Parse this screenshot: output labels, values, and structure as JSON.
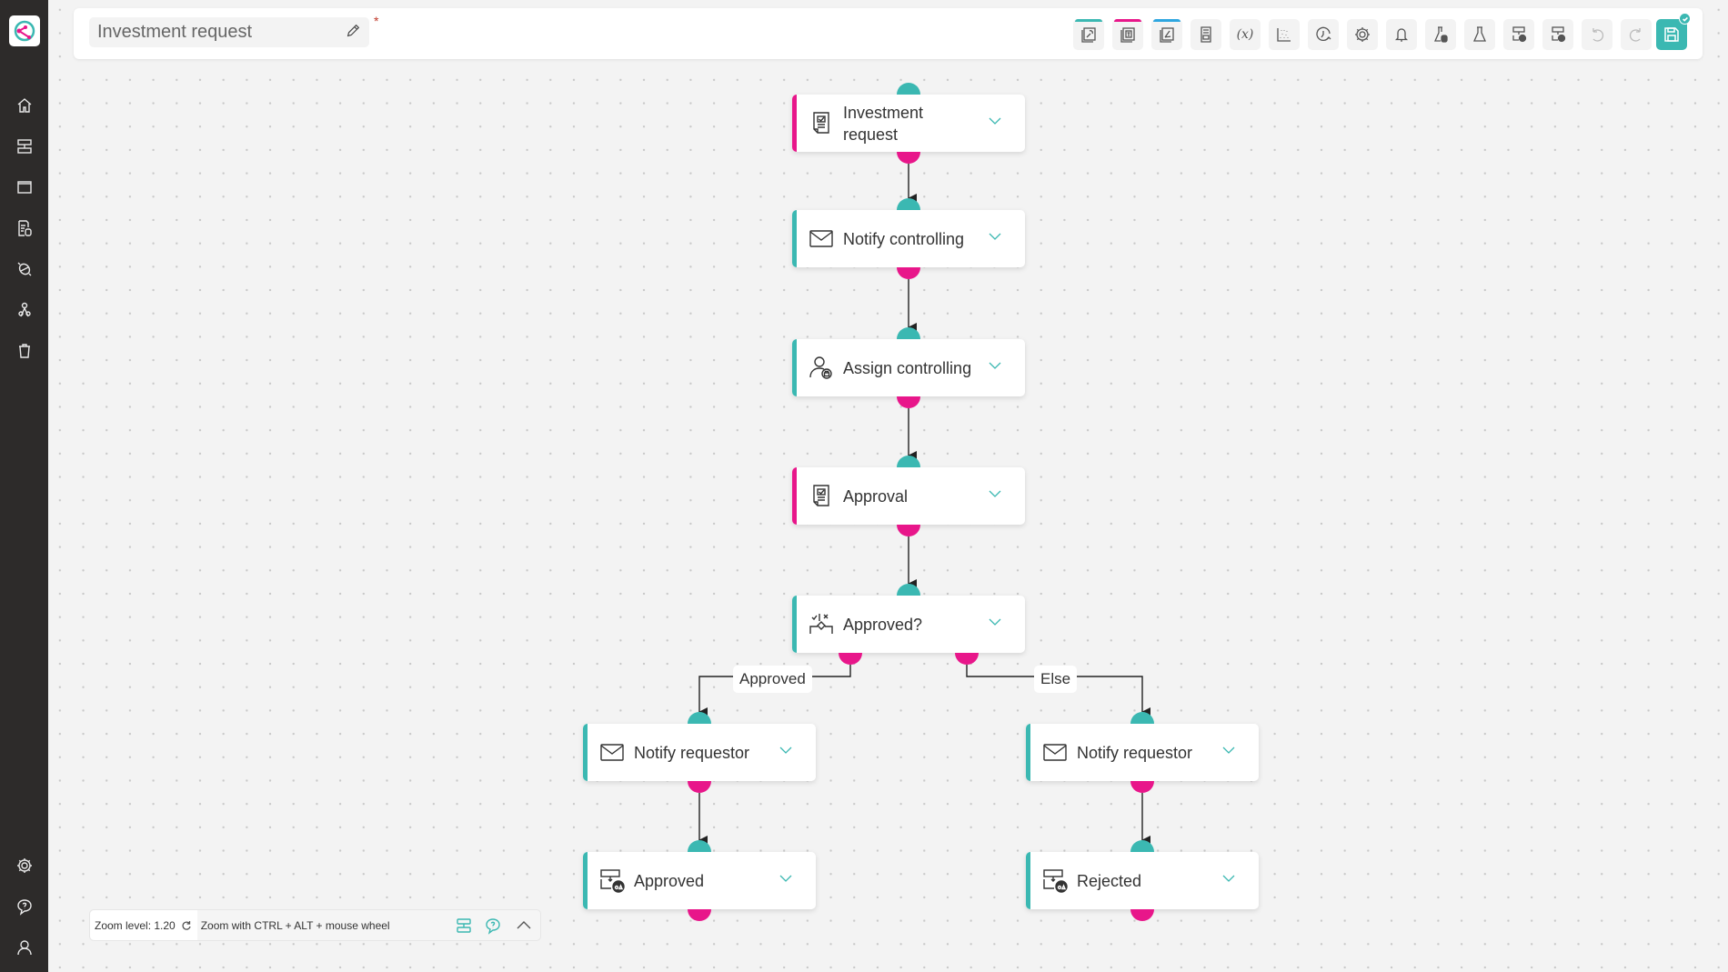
{
  "app": {
    "logo": "app-logo",
    "accent_color": "#3bb8b2",
    "secondary_color": "#e8168a",
    "sidebar_bg": "#2d2b2a"
  },
  "sidebar": {
    "top_items": [
      {
        "name": "home",
        "icon": "home-icon"
      },
      {
        "name": "processes",
        "icon": "process-icon"
      },
      {
        "name": "folders",
        "icon": "folder-icon"
      },
      {
        "name": "forms-db",
        "icon": "form-database-icon"
      },
      {
        "name": "integrations",
        "icon": "plug-icon"
      },
      {
        "name": "users",
        "icon": "users-icon"
      },
      {
        "name": "trash",
        "icon": "trash-icon"
      }
    ],
    "bottom_items": [
      {
        "name": "settings",
        "icon": "gear-icon"
      },
      {
        "name": "help",
        "icon": "help-bubble-icon"
      },
      {
        "name": "profile",
        "icon": "user-icon"
      }
    ]
  },
  "header": {
    "title": "Investment request",
    "unsaved_marker": "*",
    "toolbar": [
      {
        "name": "form-designer",
        "icon": "form-wrench-icon",
        "accent": "#3bb8b2"
      },
      {
        "name": "template-designer",
        "icon": "template-text-icon",
        "accent": "#e8168a"
      },
      {
        "name": "signature-designer",
        "icon": "signature-icon",
        "accent": "#2ea6e0"
      },
      {
        "name": "document",
        "icon": "document-icon"
      },
      {
        "name": "variables",
        "icon": "variables-icon",
        "text": "(x)"
      },
      {
        "name": "data-scatter",
        "icon": "data-dots-icon"
      },
      {
        "name": "schedule",
        "icon": "clock-refresh-icon"
      },
      {
        "name": "settings",
        "icon": "gear-icon"
      },
      {
        "name": "notifications",
        "icon": "bell-icon"
      },
      {
        "name": "test-data",
        "icon": "flask-database-icon"
      },
      {
        "name": "test",
        "icon": "flask-icon"
      },
      {
        "name": "run-report-1",
        "icon": "process-report-icon"
      },
      {
        "name": "run-report-2",
        "icon": "process-report-icon"
      },
      {
        "name": "undo",
        "icon": "undo-icon",
        "disabled": true
      },
      {
        "name": "redo",
        "icon": "redo-icon",
        "disabled": true
      }
    ],
    "save": {
      "icon": "save-icon",
      "status": "saved"
    }
  },
  "workflow": {
    "nodes": [
      {
        "id": "n1",
        "label": "Investment request",
        "type": "form",
        "bar": "#e8168a"
      },
      {
        "id": "n2",
        "label": "Notify controlling",
        "type": "email",
        "bar": "#3bb8b2"
      },
      {
        "id": "n3",
        "label": "Assign controlling",
        "type": "assign",
        "bar": "#3bb8b2"
      },
      {
        "id": "n4",
        "label": "Approval",
        "type": "form",
        "bar": "#e8168a"
      },
      {
        "id": "n5",
        "label": "Approved?",
        "type": "decision",
        "bar": "#3bb8b2"
      },
      {
        "id": "n6",
        "label": "Notify requestor",
        "type": "email",
        "bar": "#3bb8b2"
      },
      {
        "id": "n7",
        "label": "Notify requestor",
        "type": "email",
        "bar": "#3bb8b2"
      },
      {
        "id": "n8",
        "label": "Approved",
        "type": "status",
        "bar": "#3bb8b2"
      },
      {
        "id": "n9",
        "label": "Rejected",
        "type": "status",
        "bar": "#3bb8b2"
      }
    ],
    "edges": [
      {
        "from": "n1",
        "to": "n2"
      },
      {
        "from": "n2",
        "to": "n3"
      },
      {
        "from": "n3",
        "to": "n4"
      },
      {
        "from": "n4",
        "to": "n5"
      },
      {
        "from": "n5",
        "to": "n6",
        "label": "Approved"
      },
      {
        "from": "n5",
        "to": "n7",
        "label": "Else"
      },
      {
        "from": "n6",
        "to": "n8"
      },
      {
        "from": "n7",
        "to": "n9"
      }
    ]
  },
  "zoom_bar": {
    "level_text": "Zoom level: 1.20",
    "hint": "Zoom with CTRL + ALT + mouse wheel"
  }
}
